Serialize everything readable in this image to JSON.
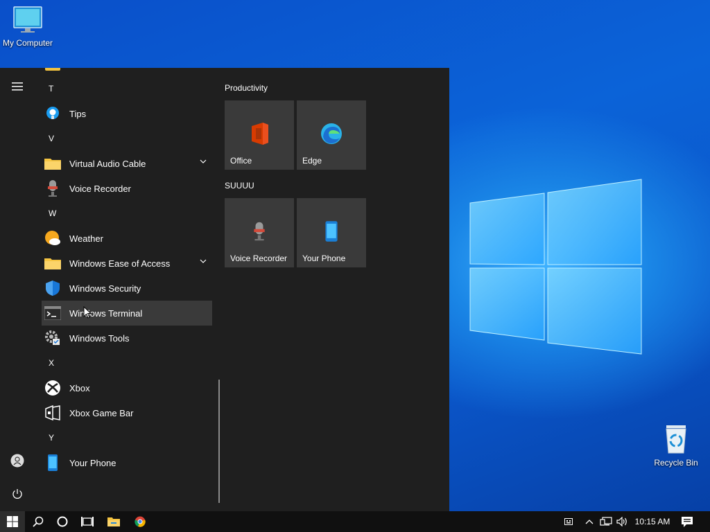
{
  "desktop": {
    "icons": [
      {
        "label": "My Computer",
        "icon": "computer-icon"
      },
      {
        "label": "Recycle Bin",
        "icon": "recycle-bin-icon"
      }
    ]
  },
  "start_menu": {
    "rail": {
      "menu_icon": "hamburger-icon",
      "user_icon": "user-icon",
      "power_icon": "power-icon"
    },
    "app_list": [
      {
        "type": "letter",
        "label": "T"
      },
      {
        "type": "app",
        "label": "Tips",
        "icon": "tips-icon"
      },
      {
        "type": "letter",
        "label": "V"
      },
      {
        "type": "app",
        "label": "Virtual Audio Cable",
        "icon": "folder-icon",
        "expandable": true
      },
      {
        "type": "app",
        "label": "Voice Recorder",
        "icon": "microphone-icon"
      },
      {
        "type": "letter",
        "label": "W"
      },
      {
        "type": "app",
        "label": "Weather",
        "icon": "weather-icon"
      },
      {
        "type": "app",
        "label": "Windows Ease of Access",
        "icon": "folder-icon",
        "expandable": true
      },
      {
        "type": "app",
        "label": "Windows Security",
        "icon": "shield-icon"
      },
      {
        "type": "app",
        "label": "Windows Terminal",
        "icon": "terminal-icon",
        "hovered": true
      },
      {
        "type": "app",
        "label": "Windows Tools",
        "icon": "tools-icon"
      },
      {
        "type": "letter",
        "label": "X"
      },
      {
        "type": "app",
        "label": "Xbox",
        "icon": "xbox-icon"
      },
      {
        "type": "app",
        "label": "Xbox Game Bar",
        "icon": "game-bar-icon"
      },
      {
        "type": "letter",
        "label": "Y"
      },
      {
        "type": "app",
        "label": "Your Phone",
        "icon": "phone-icon"
      }
    ],
    "tile_groups": [
      {
        "title": "Productivity",
        "tiles": [
          {
            "label": "Office",
            "icon": "office-icon"
          },
          {
            "label": "Edge",
            "icon": "edge-icon"
          }
        ]
      },
      {
        "title": "SUUUU",
        "tiles": [
          {
            "label": "Voice Recorder",
            "icon": "microphone-icon"
          },
          {
            "label": "Your Phone",
            "icon": "phone-icon"
          }
        ]
      }
    ]
  },
  "taskbar": {
    "pinned": [
      "start-icon",
      "search-icon",
      "cortana-icon",
      "task-view-icon",
      "file-explorer-icon",
      "chrome-icon"
    ],
    "tray": [
      "keyboard-icon",
      "chevron-up-icon",
      "network-icon",
      "volume-icon"
    ],
    "clock": "10:15 AM",
    "notification_icon": "notification-icon"
  },
  "colors": {
    "desktop_blue": "#0b63d8",
    "start_bg": "#1f1f1f",
    "tile_bg": "#3a3a3a",
    "taskbar_bg": "#101010"
  }
}
